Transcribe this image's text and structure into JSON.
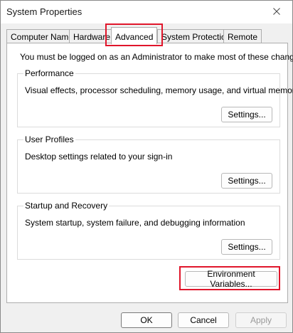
{
  "window": {
    "title": "System Properties"
  },
  "tabs": [
    {
      "label": "Computer Name",
      "active": false
    },
    {
      "label": "Hardware",
      "active": false
    },
    {
      "label": "Advanced",
      "active": true
    },
    {
      "label": "System Protection",
      "active": false
    },
    {
      "label": "Remote",
      "active": false
    }
  ],
  "advanced": {
    "admin_note": "You must be logged on as an Administrator to make most of these changes.",
    "performance": {
      "label": "Performance",
      "description": "Visual effects, processor scheduling, memory usage, and virtual memory",
      "button": "Settings..."
    },
    "user_profiles": {
      "label": "User Profiles",
      "description": "Desktop settings related to your sign-in",
      "button": "Settings..."
    },
    "startup_recovery": {
      "label": "Startup and Recovery",
      "description": "System startup, system failure, and debugging information",
      "button": "Settings..."
    },
    "env_button": "Environment Variables..."
  },
  "footer": {
    "ok": "OK",
    "cancel": "Cancel",
    "apply": "Apply"
  },
  "colors": {
    "highlight": "#e0162b"
  },
  "icons": {
    "close": "close-icon"
  }
}
